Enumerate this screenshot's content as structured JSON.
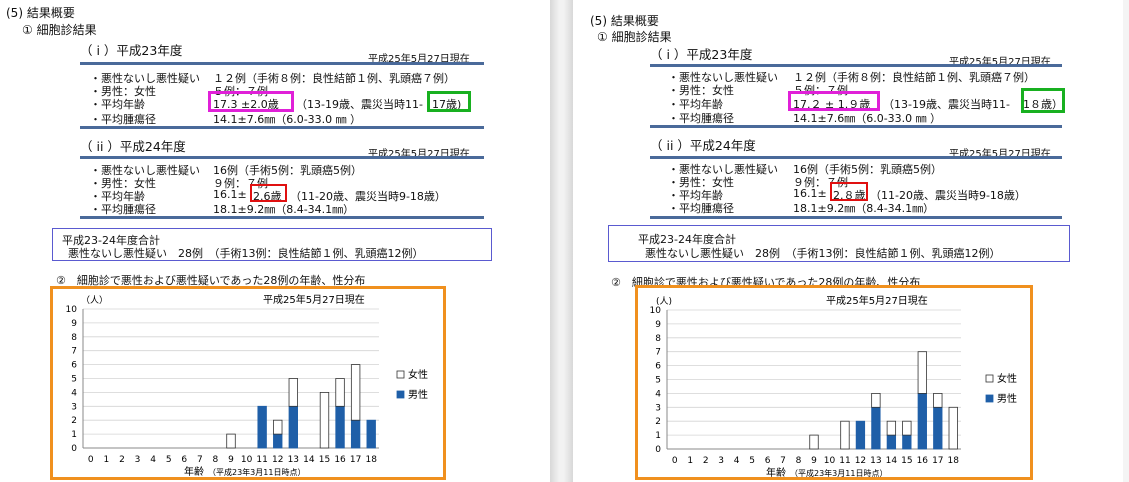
{
  "colors": {
    "male": "#1f5fa8",
    "female": "#ffffff",
    "rule": "#4a6a9a",
    "highlight_magenta": "#e020d8",
    "highlight_green": "#18b020",
    "highlight_red": "#e01010",
    "chart_border": "#f0901e"
  },
  "pages": [
    {
      "section": "(5) 結果概要",
      "subsection": "① 細胞診結果",
      "date_stamp": "平成25年5月27日現在",
      "h23": {
        "title": "（ i ）平成23年度",
        "date": "平成25年5月27日現在",
        "rows": [
          {
            "label": "・悪性ないし悪性疑い",
            "value": "１２例（手術８例：良性結節１例、乳頭癌７例）"
          },
          {
            "label": "・男性：女性",
            "value": "５例：７例"
          },
          {
            "label": "・平均年齢",
            "value_a": "17.3 ±2.0歳",
            "value_b": "（13-19歳、震災当時11-",
            "value_c": "17歳)"
          },
          {
            "label": "・平均腫瘍径",
            "value": "14.1±7.6㎜（6.0-33.0 ㎜ ）"
          }
        ]
      },
      "h24": {
        "title": "（ ii ）平成24年度",
        "date": "平成25年5月27日現在",
        "rows": [
          {
            "label": "・悪性ないし悪性疑い",
            "value": "16例（手術5例：乳頭癌5例）"
          },
          {
            "label": "・男性：女性",
            "value": "９例：７例"
          },
          {
            "label": "・平均年齢",
            "value_a": "16.1±",
            "value_b": "2.6歳",
            "value_c": "（11-20歳、震災当時9-18歳）"
          },
          {
            "label": "・平均腫瘍径",
            "value": "18.1±9.2㎜（8.4-34.1㎜）"
          }
        ]
      },
      "summary": {
        "line1": "平成23-24年度合計",
        "line2": "悪性ないし悪性疑い　28例　（手術13例：良性結節１例、乳頭癌12例）"
      },
      "section2": "②　細胞診で悪性および悪性疑いであった28例の年齢、性分布",
      "chart_data": {
        "type": "bar",
        "stacked": true,
        "date": "平成25年5月27日現在",
        "ylabel": "（人）",
        "xlabel": "年齢",
        "xlabel_note": "（平成23年3月11日時点）",
        "ylim": [
          0,
          10
        ],
        "yticks": [
          "0",
          "1",
          "2",
          "3",
          "4",
          "5",
          "6",
          "7",
          "8",
          "9",
          "10"
        ],
        "categories": [
          "0",
          "1",
          "2",
          "3",
          "4",
          "5",
          "6",
          "7",
          "8",
          "9",
          "10",
          "11",
          "12",
          "13",
          "14",
          "15",
          "16",
          "17",
          "18"
        ],
        "series": [
          {
            "name": "男性",
            "color": "#1f5fa8",
            "values": [
              0,
              0,
              0,
              0,
              0,
              0,
              0,
              0,
              0,
              0,
              0,
              3,
              1,
              3,
              0,
              0,
              3,
              2,
              2
            ]
          },
          {
            "name": "女性",
            "color": "#ffffff",
            "values": [
              0,
              0,
              0,
              0,
              0,
              0,
              0,
              0,
              0,
              1,
              0,
              0,
              1,
              2,
              0,
              4,
              2,
              4,
              0
            ]
          }
        ],
        "legend_position": "right"
      }
    },
    {
      "section": "(5) 結果概要",
      "subsection": "① 細胞診結果",
      "h23": {
        "title": "（ i ）平成23年度",
        "date": "平成25年5月27日現在",
        "rows": [
          {
            "label": "・悪性ないし悪性疑い",
            "value": "１２例（手術８例：良性結節１例、乳頭癌７例）"
          },
          {
            "label": "・男性：女性",
            "value": "５例：７例"
          },
          {
            "label": "・平均年齢",
            "value_a": "17.２ ± 1.９歳",
            "value_b": "（13-19歳、震災当時11-",
            "value_c": "1８歳）"
          },
          {
            "label": "・平均腫瘍径",
            "value": "14.1±7.6㎜（6.0-33.0 ㎜ ）"
          }
        ]
      },
      "h24": {
        "title": "（ ii ）平成24年度",
        "date": "平成25年5月27日現在",
        "rows": [
          {
            "label": "・悪性ないし悪性疑い",
            "value": "16例（手術5例：乳頭癌5例）"
          },
          {
            "label": "・男性：女性",
            "value": "９例：７例"
          },
          {
            "label": "・平均年齢",
            "value_a": "16.1±",
            "value_b": "2.８歳",
            "value_c": "（11-20歳、震災当時9-18歳）"
          },
          {
            "label": "・平均腫瘍径",
            "value": "18.1±9.2㎜（8.4-34.1㎜）"
          }
        ]
      },
      "summary": {
        "line1": "平成23-24年度合計",
        "line2": "悪性ないし悪性疑い　28例　（手術13例：良性結節１例、乳頭癌12例）"
      },
      "section2": "②　細胞診で悪性および悪性疑いであった28例の年齢、性分布",
      "chart_data": {
        "type": "bar",
        "stacked": true,
        "date": "平成25年5月27日現在",
        "ylabel": "(人)",
        "xlabel": "年齢",
        "xlabel_note": "（平成23年3月11日時点）",
        "ylim": [
          0,
          10
        ],
        "yticks": [
          "0",
          "1",
          "2",
          "3",
          "4",
          "5",
          "6",
          "7",
          "8",
          "9",
          "10"
        ],
        "categories": [
          "0",
          "1",
          "2",
          "3",
          "4",
          "5",
          "6",
          "7",
          "8",
          "9",
          "10",
          "11",
          "12",
          "13",
          "14",
          "15",
          "16",
          "17",
          "18"
        ],
        "series": [
          {
            "name": "男性",
            "color": "#1f5fa8",
            "values": [
              0,
              0,
              0,
              0,
              0,
              0,
              0,
              0,
              0,
              0,
              0,
              0,
              2,
              3,
              1,
              1,
              4,
              3,
              0
            ]
          },
          {
            "name": "女性",
            "color": "#ffffff",
            "values": [
              0,
              0,
              0,
              0,
              0,
              0,
              0,
              0,
              0,
              1,
              0,
              2,
              0,
              1,
              1,
              1,
              3,
              1,
              3
            ]
          }
        ],
        "legend_position": "right"
      }
    }
  ]
}
